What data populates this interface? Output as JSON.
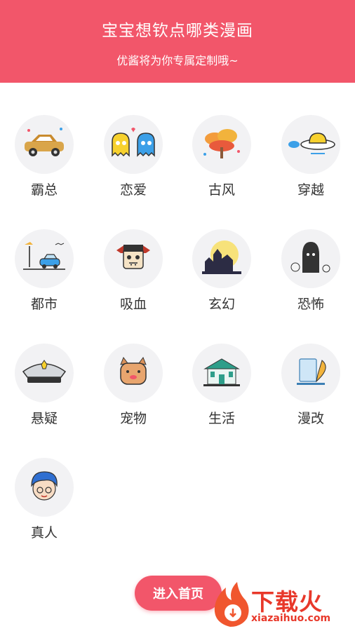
{
  "header": {
    "title": "宝宝想钦点哪类漫画",
    "subtitle": "优酱将为你专属定制哦~",
    "background_color": "#f2566a"
  },
  "categories": [
    {
      "label": "霸总",
      "icon": "sports-car-icon"
    },
    {
      "label": "恋爱",
      "icon": "ghost-couple-icon"
    },
    {
      "label": "古风",
      "icon": "ancient-tree-icon"
    },
    {
      "label": "穿越",
      "icon": "flying-saucer-icon"
    },
    {
      "label": "都市",
      "icon": "city-car-icon"
    },
    {
      "label": "吸血",
      "icon": "vampire-icon"
    },
    {
      "label": "玄幻",
      "icon": "haunted-castle-icon"
    },
    {
      "label": "恐怖",
      "icon": "grim-reaper-icon"
    },
    {
      "label": "悬疑",
      "icon": "police-cap-icon"
    },
    {
      "label": "宠物",
      "icon": "pet-dog-icon"
    },
    {
      "label": "生活",
      "icon": "building-icon"
    },
    {
      "label": "漫改",
      "icon": "paper-quill-icon"
    },
    {
      "label": "真人",
      "icon": "person-face-icon"
    }
  ],
  "enter_button": {
    "label": "进入首页"
  },
  "watermark": {
    "brand": "下载火",
    "url": "xiazaihuo.com"
  }
}
